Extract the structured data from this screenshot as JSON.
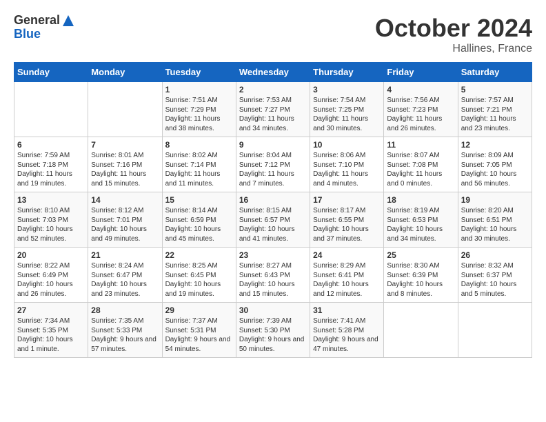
{
  "header": {
    "logo_general": "General",
    "logo_blue": "Blue",
    "month_title": "October 2024",
    "location": "Hallines, France"
  },
  "days_of_week": [
    "Sunday",
    "Monday",
    "Tuesday",
    "Wednesday",
    "Thursday",
    "Friday",
    "Saturday"
  ],
  "weeks": [
    [
      {
        "day": "",
        "sunrise": "",
        "sunset": "",
        "daylight": ""
      },
      {
        "day": "",
        "sunrise": "",
        "sunset": "",
        "daylight": ""
      },
      {
        "day": "1",
        "sunrise": "Sunrise: 7:51 AM",
        "sunset": "Sunset: 7:29 PM",
        "daylight": "Daylight: 11 hours and 38 minutes."
      },
      {
        "day": "2",
        "sunrise": "Sunrise: 7:53 AM",
        "sunset": "Sunset: 7:27 PM",
        "daylight": "Daylight: 11 hours and 34 minutes."
      },
      {
        "day": "3",
        "sunrise": "Sunrise: 7:54 AM",
        "sunset": "Sunset: 7:25 PM",
        "daylight": "Daylight: 11 hours and 30 minutes."
      },
      {
        "day": "4",
        "sunrise": "Sunrise: 7:56 AM",
        "sunset": "Sunset: 7:23 PM",
        "daylight": "Daylight: 11 hours and 26 minutes."
      },
      {
        "day": "5",
        "sunrise": "Sunrise: 7:57 AM",
        "sunset": "Sunset: 7:21 PM",
        "daylight": "Daylight: 11 hours and 23 minutes."
      }
    ],
    [
      {
        "day": "6",
        "sunrise": "Sunrise: 7:59 AM",
        "sunset": "Sunset: 7:18 PM",
        "daylight": "Daylight: 11 hours and 19 minutes."
      },
      {
        "day": "7",
        "sunrise": "Sunrise: 8:01 AM",
        "sunset": "Sunset: 7:16 PM",
        "daylight": "Daylight: 11 hours and 15 minutes."
      },
      {
        "day": "8",
        "sunrise": "Sunrise: 8:02 AM",
        "sunset": "Sunset: 7:14 PM",
        "daylight": "Daylight: 11 hours and 11 minutes."
      },
      {
        "day": "9",
        "sunrise": "Sunrise: 8:04 AM",
        "sunset": "Sunset: 7:12 PM",
        "daylight": "Daylight: 11 hours and 7 minutes."
      },
      {
        "day": "10",
        "sunrise": "Sunrise: 8:06 AM",
        "sunset": "Sunset: 7:10 PM",
        "daylight": "Daylight: 11 hours and 4 minutes."
      },
      {
        "day": "11",
        "sunrise": "Sunrise: 8:07 AM",
        "sunset": "Sunset: 7:08 PM",
        "daylight": "Daylight: 11 hours and 0 minutes."
      },
      {
        "day": "12",
        "sunrise": "Sunrise: 8:09 AM",
        "sunset": "Sunset: 7:05 PM",
        "daylight": "Daylight: 10 hours and 56 minutes."
      }
    ],
    [
      {
        "day": "13",
        "sunrise": "Sunrise: 8:10 AM",
        "sunset": "Sunset: 7:03 PM",
        "daylight": "Daylight: 10 hours and 52 minutes."
      },
      {
        "day": "14",
        "sunrise": "Sunrise: 8:12 AM",
        "sunset": "Sunset: 7:01 PM",
        "daylight": "Daylight: 10 hours and 49 minutes."
      },
      {
        "day": "15",
        "sunrise": "Sunrise: 8:14 AM",
        "sunset": "Sunset: 6:59 PM",
        "daylight": "Daylight: 10 hours and 45 minutes."
      },
      {
        "day": "16",
        "sunrise": "Sunrise: 8:15 AM",
        "sunset": "Sunset: 6:57 PM",
        "daylight": "Daylight: 10 hours and 41 minutes."
      },
      {
        "day": "17",
        "sunrise": "Sunrise: 8:17 AM",
        "sunset": "Sunset: 6:55 PM",
        "daylight": "Daylight: 10 hours and 37 minutes."
      },
      {
        "day": "18",
        "sunrise": "Sunrise: 8:19 AM",
        "sunset": "Sunset: 6:53 PM",
        "daylight": "Daylight: 10 hours and 34 minutes."
      },
      {
        "day": "19",
        "sunrise": "Sunrise: 8:20 AM",
        "sunset": "Sunset: 6:51 PM",
        "daylight": "Daylight: 10 hours and 30 minutes."
      }
    ],
    [
      {
        "day": "20",
        "sunrise": "Sunrise: 8:22 AM",
        "sunset": "Sunset: 6:49 PM",
        "daylight": "Daylight: 10 hours and 26 minutes."
      },
      {
        "day": "21",
        "sunrise": "Sunrise: 8:24 AM",
        "sunset": "Sunset: 6:47 PM",
        "daylight": "Daylight: 10 hours and 23 minutes."
      },
      {
        "day": "22",
        "sunrise": "Sunrise: 8:25 AM",
        "sunset": "Sunset: 6:45 PM",
        "daylight": "Daylight: 10 hours and 19 minutes."
      },
      {
        "day": "23",
        "sunrise": "Sunrise: 8:27 AM",
        "sunset": "Sunset: 6:43 PM",
        "daylight": "Daylight: 10 hours and 15 minutes."
      },
      {
        "day": "24",
        "sunrise": "Sunrise: 8:29 AM",
        "sunset": "Sunset: 6:41 PM",
        "daylight": "Daylight: 10 hours and 12 minutes."
      },
      {
        "day": "25",
        "sunrise": "Sunrise: 8:30 AM",
        "sunset": "Sunset: 6:39 PM",
        "daylight": "Daylight: 10 hours and 8 minutes."
      },
      {
        "day": "26",
        "sunrise": "Sunrise: 8:32 AM",
        "sunset": "Sunset: 6:37 PM",
        "daylight": "Daylight: 10 hours and 5 minutes."
      }
    ],
    [
      {
        "day": "27",
        "sunrise": "Sunrise: 7:34 AM",
        "sunset": "Sunset: 5:35 PM",
        "daylight": "Daylight: 10 hours and 1 minute."
      },
      {
        "day": "28",
        "sunrise": "Sunrise: 7:35 AM",
        "sunset": "Sunset: 5:33 PM",
        "daylight": "Daylight: 9 hours and 57 minutes."
      },
      {
        "day": "29",
        "sunrise": "Sunrise: 7:37 AM",
        "sunset": "Sunset: 5:31 PM",
        "daylight": "Daylight: 9 hours and 54 minutes."
      },
      {
        "day": "30",
        "sunrise": "Sunrise: 7:39 AM",
        "sunset": "Sunset: 5:30 PM",
        "daylight": "Daylight: 9 hours and 50 minutes."
      },
      {
        "day": "31",
        "sunrise": "Sunrise: 7:41 AM",
        "sunset": "Sunset: 5:28 PM",
        "daylight": "Daylight: 9 hours and 47 minutes."
      },
      {
        "day": "",
        "sunrise": "",
        "sunset": "",
        "daylight": ""
      },
      {
        "day": "",
        "sunrise": "",
        "sunset": "",
        "daylight": ""
      }
    ]
  ]
}
